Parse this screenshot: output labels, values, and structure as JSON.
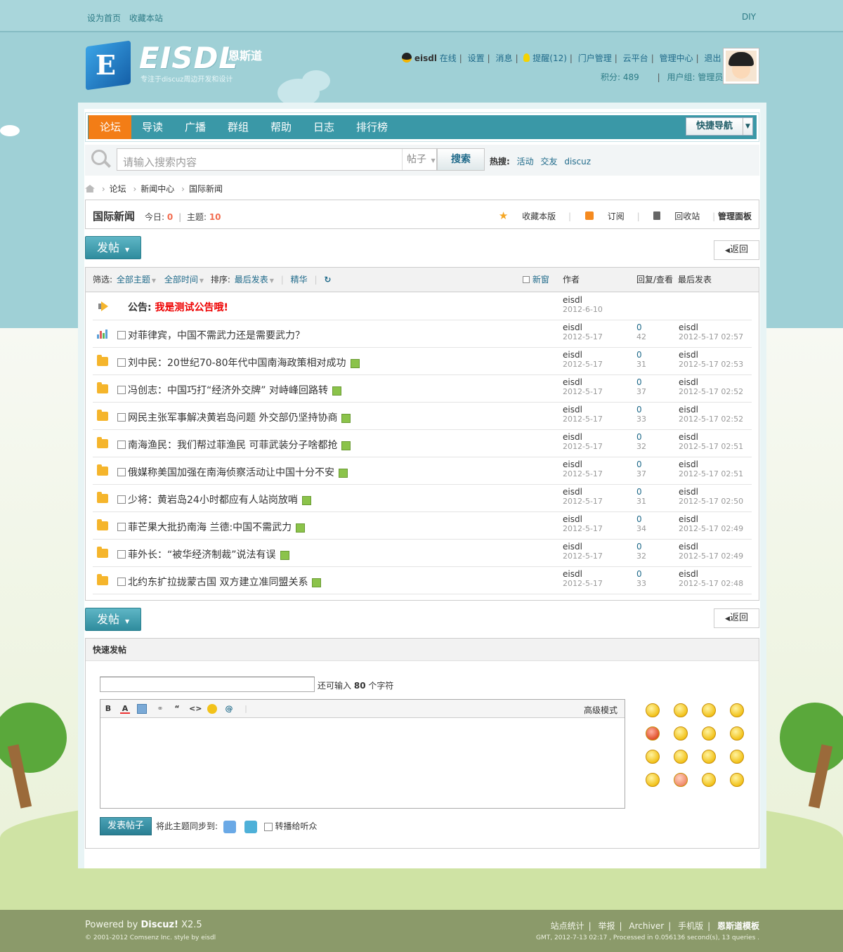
{
  "topbar": {
    "set_home": "设为首页",
    "bookmark": "收藏本站",
    "diy": "DIY"
  },
  "logo": {
    "text": "EISDL",
    "cn": "恩斯道",
    "subtitle": "专注于discuz周边开发和设计"
  },
  "user": {
    "name": "eisdl",
    "status": "在线",
    "links": [
      "设置",
      "消息"
    ],
    "remind": "提醒(12)",
    "links2": [
      "门户管理",
      "云平台",
      "管理中心",
      "退出"
    ],
    "points_label": "积分: 489",
    "group_label": "用户组: 管理员"
  },
  "nav": {
    "items": [
      "论坛",
      "导读",
      "广播",
      "群组",
      "帮助",
      "日志",
      "排行榜"
    ],
    "active": "论坛",
    "quick_nav": "快捷导航"
  },
  "search": {
    "placeholder": "请输入搜索内容",
    "type": "帖子",
    "button": "搜索",
    "hot_label": "热搜:",
    "hot": [
      "活动",
      "交友",
      "discuz"
    ]
  },
  "breadcrumb": [
    "论坛",
    "新闻中心",
    "国际新闻"
  ],
  "forum": {
    "name": "国际新闻",
    "today_label": "今日:",
    "today": "0",
    "threads_label": "主题:",
    "threads": "10",
    "actions": [
      "收藏本版",
      "订阅",
      "回收站",
      "管理面板"
    ]
  },
  "buttons": {
    "post": "发帖",
    "back": "返回"
  },
  "list_head": {
    "filter_label": "筛选:",
    "all_threads": "全部主题",
    "all_time": "全部时间",
    "sort_label": "排序:",
    "last_post": "最后发表",
    "digest": "精华",
    "new_window": "新窗",
    "author": "作者",
    "replies_views": "回复/查看",
    "last": "最后发表"
  },
  "announcement": {
    "label": "公告:",
    "title": "我是测试公告哦!",
    "author": "eisdl",
    "date": "2012-6-10"
  },
  "threads": [
    {
      "title": "对菲律宾，中国不需武力还是需要武力？",
      "author": "eisdl",
      "date": "2012-5-17",
      "replies": "0",
      "views": "42",
      "last_user": "eisdl",
      "last_time": "2012-5-17 02:57",
      "type": "poll"
    },
    {
      "title": "刘中民：20世纪70-80年代中国南海政策相对成功",
      "author": "eisdl",
      "date": "2012-5-17",
      "replies": "0",
      "views": "31",
      "last_user": "eisdl",
      "last_time": "2012-5-17 02:53",
      "type": "normal"
    },
    {
      "title": "冯创志：中国巧打“经济外交牌” 对峙峰回路转",
      "author": "eisdl",
      "date": "2012-5-17",
      "replies": "0",
      "views": "37",
      "last_user": "eisdl",
      "last_time": "2012-5-17 02:52",
      "type": "normal"
    },
    {
      "title": "网民主张军事解决黄岩岛问题 外交部仍坚持协商",
      "author": "eisdl",
      "date": "2012-5-17",
      "replies": "0",
      "views": "33",
      "last_user": "eisdl",
      "last_time": "2012-5-17 02:52",
      "type": "normal"
    },
    {
      "title": "南海渔民：我们帮过菲渔民 可菲武装分子啥都抢",
      "author": "eisdl",
      "date": "2012-5-17",
      "replies": "0",
      "views": "32",
      "last_user": "eisdl",
      "last_time": "2012-5-17 02:51",
      "type": "normal"
    },
    {
      "title": "俄媒称美国加强在南海侦察活动让中国十分不安",
      "author": "eisdl",
      "date": "2012-5-17",
      "replies": "0",
      "views": "37",
      "last_user": "eisdl",
      "last_time": "2012-5-17 02:51",
      "type": "normal"
    },
    {
      "title": "少将：黄岩岛24小时都应有人站岗放哨",
      "author": "eisdl",
      "date": "2012-5-17",
      "replies": "0",
      "views": "31",
      "last_user": "eisdl",
      "last_time": "2012-5-17 02:50",
      "type": "normal"
    },
    {
      "title": "菲芒果大批扔南海 兰德:中国不需武力",
      "author": "eisdl",
      "date": "2012-5-17",
      "replies": "0",
      "views": "34",
      "last_user": "eisdl",
      "last_time": "2012-5-17 02:49",
      "type": "normal"
    },
    {
      "title": "菲外长：“被华经济制裁”说法有误",
      "author": "eisdl",
      "date": "2012-5-17",
      "replies": "0",
      "views": "32",
      "last_user": "eisdl",
      "last_time": "2012-5-17 02:49",
      "type": "normal"
    },
    {
      "title": "北约东扩拉拢蒙古国 双方建立准同盟关系",
      "author": "eisdl",
      "date": "2012-5-17",
      "replies": "0",
      "views": "33",
      "last_user": "eisdl",
      "last_time": "2012-5-17 02:48",
      "type": "normal"
    }
  ],
  "quick_post": {
    "title": "快速发帖",
    "hint_prefix": "还可输入",
    "remaining": "80",
    "hint_suffix": "个字符",
    "advanced": "高级模式",
    "submit": "发表帖子",
    "sync_label": "将此主题同步到:",
    "relay": "转播给听众"
  },
  "footer": {
    "powered_prefix": "Powered by",
    "powered_product": "Discuz!",
    "powered_version": "X2.5",
    "copyright": "© 2001-2012 Comsenz Inc. style by eisdl",
    "links": [
      "站点统计",
      "举报",
      "Archiver",
      "手机版"
    ],
    "brand_link": "恩斯道模板",
    "gmt": "GMT, 2012-7-13 02:17 , Processed in 0.056136 second(s), 13 queries ."
  },
  "colors": {
    "nav_bg": "#3a98a7",
    "nav_active": "#f37d16",
    "link": "#1f6a8a",
    "accent_red": "#e00000",
    "footer_bg": "#8b9a6a"
  },
  "icons": [
    "qq-icon",
    "bulb-icon",
    "search-icon",
    "home-icon",
    "star-icon",
    "rss-icon",
    "trash-icon",
    "megaphone-icon",
    "poll-icon",
    "folder-icon",
    "image-attachment-icon",
    "refresh-icon"
  ]
}
